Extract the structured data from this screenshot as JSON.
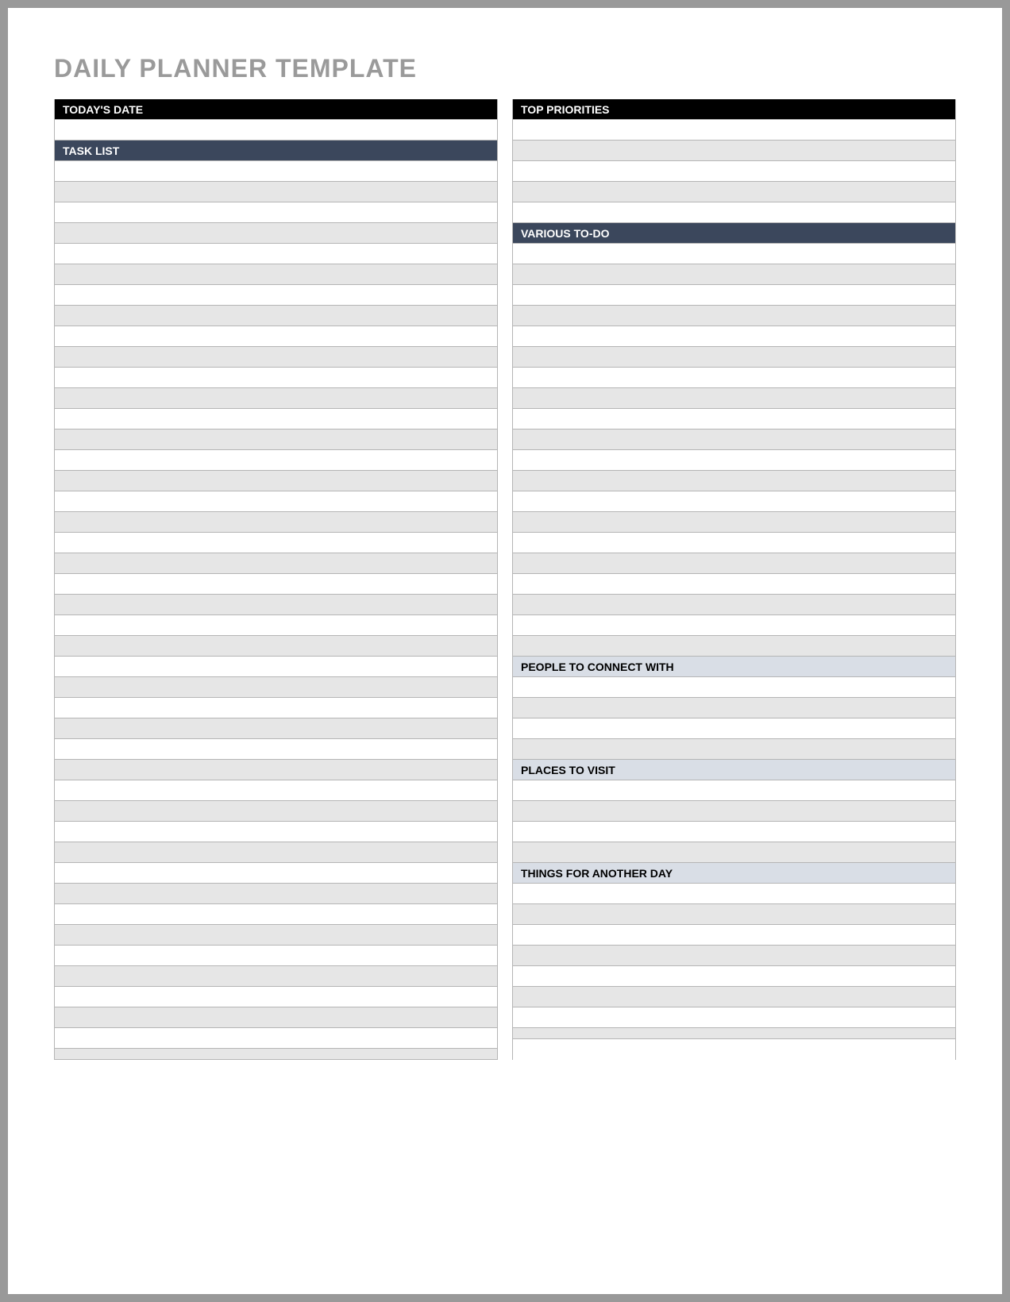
{
  "title": "DAILY PLANNER TEMPLATE",
  "left": {
    "todays_date": "TODAY'S DATE",
    "task_list": "TASK LIST"
  },
  "right": {
    "top_priorities": "TOP PRIORITIES",
    "various_todo": "VARIOUS TO-DO",
    "people_to_connect": "PEOPLE TO CONNECT WITH",
    "places_to_visit": "PLACES TO VISIT",
    "things_for_another_day": "THINGS FOR ANOTHER DAY"
  }
}
